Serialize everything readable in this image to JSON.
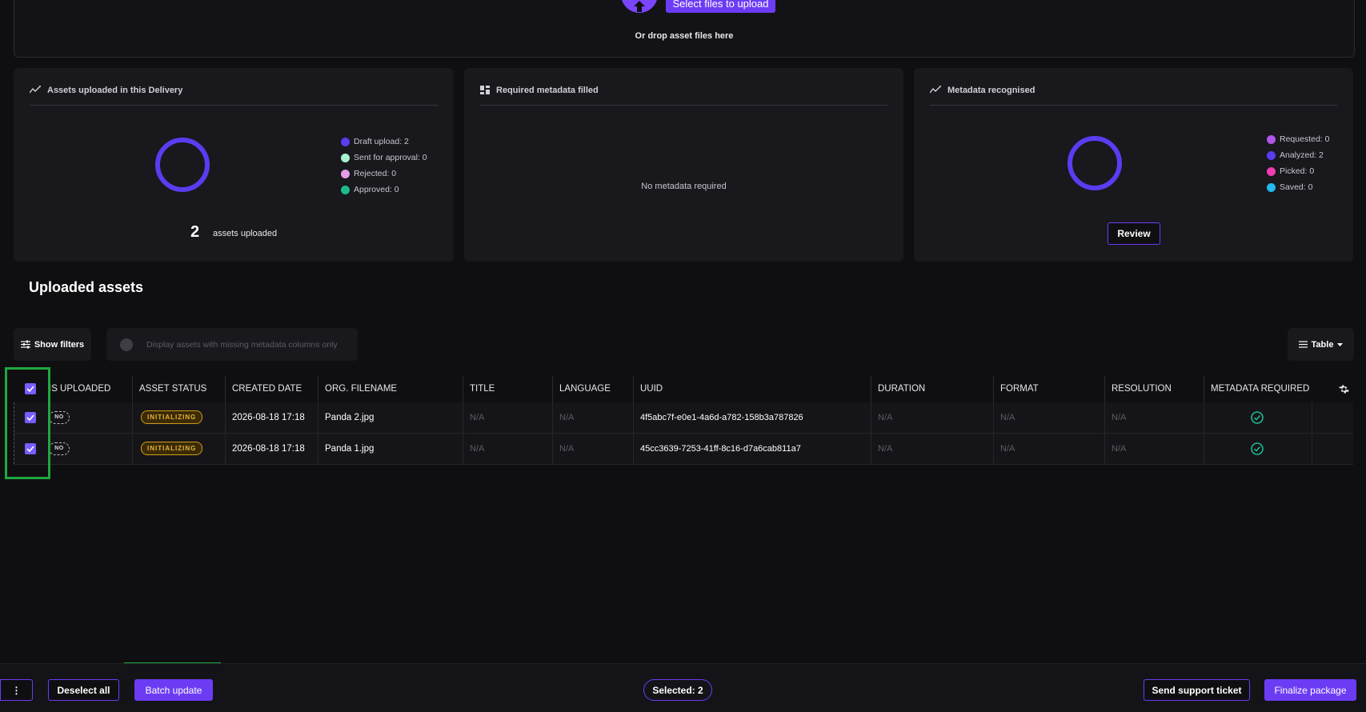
{
  "upload": {
    "button_label": "Select files to upload",
    "drop_text": "Or drop asset files here"
  },
  "cards": {
    "assets_uploaded": {
      "title": "Assets uploaded in this Delivery",
      "legend": [
        {
          "label": "Draft upload: 2",
          "color": "#5b3cf0"
        },
        {
          "label": "Sent for approval: 0",
          "color": "#a9f0cf"
        },
        {
          "label": "Rejected: 0",
          "color": "#e79ce8"
        },
        {
          "label": "Approved: 0",
          "color": "#1fb98f"
        }
      ],
      "count": "2",
      "count_label": "assets uploaded"
    },
    "required_metadata": {
      "title": "Required metadata filled",
      "empty_text": "No metadata required"
    },
    "metadata_recognised": {
      "title": "Metadata recognised",
      "legend": [
        {
          "label": "Requested: 0",
          "color": "#b156e8"
        },
        {
          "label": "Analyzed: 2",
          "color": "#5b3cf0"
        },
        {
          "label": "Picked: 0",
          "color": "#f03cb0"
        },
        {
          "label": "Saved: 0",
          "color": "#22b8f0"
        }
      ],
      "review_label": "Review"
    }
  },
  "section_title": "Uploaded assets",
  "toolbar": {
    "filters_label": "Show filters",
    "toggle_label": "Display assets with missing metadata columns only",
    "view_label": "Table"
  },
  "table": {
    "headers": [
      "IS UPLOADED",
      "ASSET STATUS",
      "CREATED DATE",
      "ORG. FILENAME",
      "TITLE",
      "LANGUAGE",
      "UUID",
      "DURATION",
      "FORMAT",
      "RESOLUTION",
      "METADATA REQUIRED"
    ],
    "rows": [
      {
        "uploaded": "NO",
        "status": "INITIALIZING",
        "created": "2026-08-18 17:18",
        "filename": "Panda 2.jpg",
        "title": "N/A",
        "language": "N/A",
        "uuid": "4f5abc7f-e0e1-4a6d-a782-158b3a787826",
        "duration": "N/A",
        "format": "N/A",
        "resolution": "N/A"
      },
      {
        "uploaded": "NO",
        "status": "INITIALIZING",
        "created": "2026-08-18 17:18",
        "filename": "Panda 1.jpg",
        "title": "N/A",
        "language": "N/A",
        "uuid": "45cc3639-7253-41ff-8c16-d7a6cab811a7",
        "duration": "N/A",
        "format": "N/A",
        "resolution": "N/A"
      }
    ]
  },
  "footer": {
    "menu_label": "⋮",
    "deselect_label": "Deselect all",
    "batch_label": "Batch update",
    "selected_label": "Selected: 2",
    "support_label": "Send support ticket",
    "finalize_label": "Finalize package"
  },
  "colors": {
    "accent": "#6c3cf5",
    "success": "#1fb98f",
    "highlight": "#1fa83d"
  }
}
